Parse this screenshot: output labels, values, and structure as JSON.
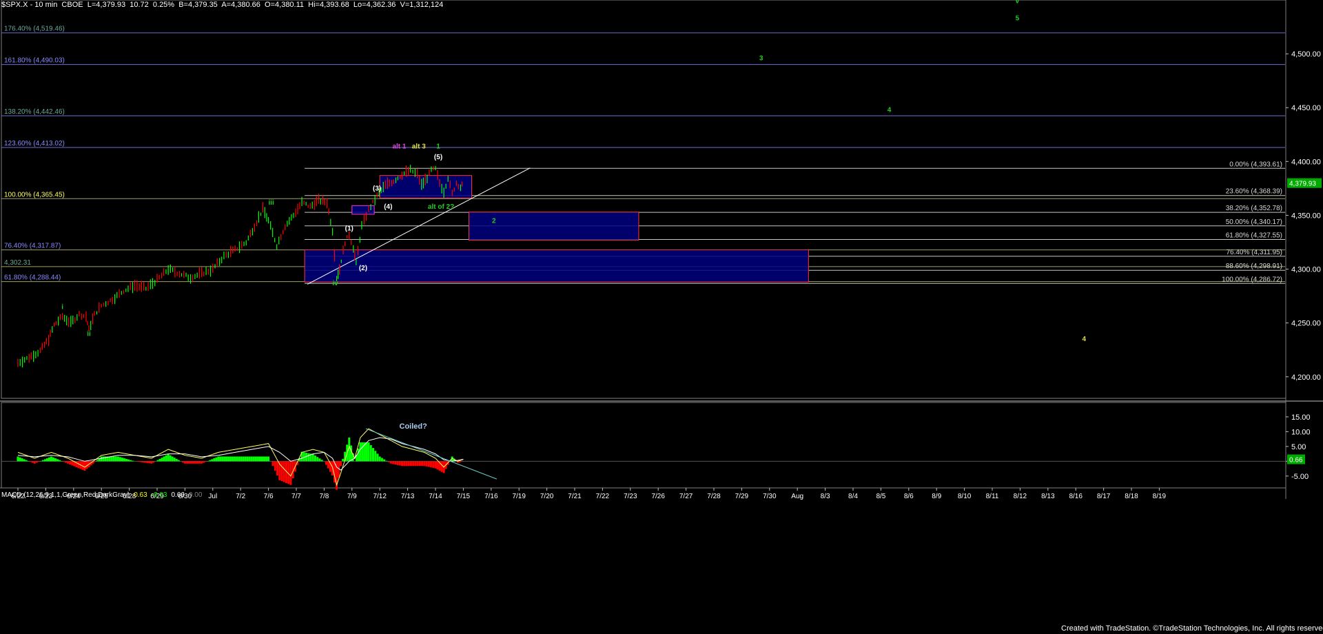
{
  "header": {
    "symbol": "$SPX.X - 10 min  CBOE",
    "last": "L=4,379.93",
    "change": "10.72",
    "change_pct": "0.25%",
    "bid": "B=4,379.35",
    "ask": "A=4,380.66",
    "open": "O=4,380.11",
    "high": "Hi=4,393.68",
    "low": "Lo=4,362.36",
    "volume": "V=1,312,124"
  },
  "macd_header": {
    "label": "MACD (12,26,9,1,1,Green,Red,DarkGray)",
    "v1": "0.63",
    "v2": "-0.03",
    "v3": "0.66",
    "v4": "0.00"
  },
  "footer": "Created with TradeStation. ©TradeStation Technologies, Inc. All rights reserved.",
  "colors": {
    "background": "#000000",
    "up_candle": "#00ff00",
    "down_candle": "#ff0000",
    "box_fill": "#00007f",
    "box_border": "#ff3333",
    "fib_left": "#8080ff",
    "fib_right": "#ffffff",
    "wave_green": "#00cc00",
    "wave_yellow": "#cccc33",
    "wave_magenta": "#cc33cc"
  },
  "chart_data": [
    {
      "type": "candlestick",
      "title": "$SPX.X - 10 min",
      "ylim": [
        4180,
        4550
      ],
      "y_ticks": [
        "4,200.00",
        "4,250.00",
        "4,300.00",
        "4,350.00",
        "4,400.00",
        "4,450.00",
        "4,500.00"
      ],
      "y_tick_values": [
        4200,
        4250,
        4300,
        4350,
        4400,
        4450,
        4500
      ],
      "last_price_label": "4,379.93",
      "last_price": 4379.93,
      "x_ticks": [
        "6/22",
        "6/23",
        "6/24",
        "6/25",
        "6/28",
        "6/29",
        "6/30",
        "Jul",
        "7/2",
        "7/6",
        "7/7",
        "7/8",
        "7/9",
        "7/12",
        "7/13",
        "7/14",
        "7/15",
        "7/16",
        "7/19",
        "7/20",
        "7/21",
        "7/22",
        "7/23",
        "7/26",
        "7/27",
        "7/28",
        "7/29",
        "7/30",
        "Aug",
        "8/3",
        "8/4",
        "8/5",
        "8/6",
        "8/9",
        "8/10",
        "8/11",
        "8/12",
        "8/13",
        "8/16",
        "8/17",
        "8/18",
        "8/19"
      ],
      "price_path": [
        [
          0,
          4213
        ],
        [
          0.4,
          4218
        ],
        [
          0.8,
          4224
        ],
        [
          1.1,
          4235
        ],
        [
          1.3,
          4248
        ],
        [
          1.6,
          4256
        ],
        [
          1.9,
          4250
        ],
        [
          2.2,
          4258
        ],
        [
          2.45,
          4256
        ],
        [
          2.55,
          4244
        ],
        [
          2.75,
          4258
        ],
        [
          3.0,
          4266
        ],
        [
          3.4,
          4272
        ],
        [
          3.8,
          4280
        ],
        [
          4.2,
          4285
        ],
        [
          4.6,
          4282
        ],
        [
          5.0,
          4290
        ],
        [
          5.4,
          4300
        ],
        [
          5.8,
          4296
        ],
        [
          6.2,
          4292
        ],
        [
          6.6,
          4296
        ],
        [
          7.0,
          4300
        ],
        [
          7.4,
          4312
        ],
        [
          7.8,
          4318
        ],
        [
          8.2,
          4325
        ],
        [
          8.5,
          4340
        ],
        [
          8.8,
          4356
        ],
        [
          9.0,
          4345
        ],
        [
          9.3,
          4322
        ],
        [
          9.6,
          4340
        ],
        [
          9.9,
          4350
        ],
        [
          10.2,
          4362
        ],
        [
          10.5,
          4358
        ],
        [
          10.8,
          4364
        ],
        [
          11.1,
          4362
        ],
        [
          11.3,
          4336
        ],
        [
          11.45,
          4292
        ],
        [
          11.55,
          4300
        ],
        [
          11.75,
          4325
        ],
        [
          11.9,
          4332
        ],
        [
          12.05,
          4320
        ],
        [
          12.15,
          4305
        ],
        [
          12.35,
          4340
        ],
        [
          12.6,
          4355
        ],
        [
          12.9,
          4368
        ],
        [
          13.2,
          4378
        ],
        [
          13.5,
          4382
        ],
        [
          13.8,
          4388
        ],
        [
          14.1,
          4392
        ],
        [
          14.35,
          4388
        ],
        [
          14.5,
          4378
        ],
        [
          14.7,
          4385
        ],
        [
          14.85,
          4392
        ],
        [
          15.0,
          4393
        ],
        [
          15.15,
          4380
        ],
        [
          15.3,
          4372
        ],
        [
          15.45,
          4385
        ],
        [
          15.6,
          4370
        ],
        [
          15.75,
          4380
        ],
        [
          15.9,
          4376
        ],
        [
          16.0,
          4379.93
        ]
      ],
      "fib_levels_left": [
        {
          "label": "176.40% (4,519.46)",
          "price": 4519.46
        },
        {
          "label": "161.80% (4,490.03)",
          "price": 4490.03
        },
        {
          "label": "138.20% (4,442.46)",
          "price": 4442.46
        },
        {
          "label": "123.60% (4,413.02)",
          "price": 4413.02
        },
        {
          "label": "100.00% (4,365.45)",
          "price": 4365.45
        },
        {
          "label": "76.40% (4,317.87)",
          "price": 4317.87
        },
        {
          "label": "4,302.31",
          "price": 4302.31
        },
        {
          "label": "61.80% (4,288.44)",
          "price": 4288.44
        }
      ],
      "fib_levels_right": [
        {
          "label": "0.00% (4,393.61)",
          "price": 4393.61
        },
        {
          "label": "23.60% (4,368.39)",
          "price": 4368.39
        },
        {
          "label": "38.20% (4,352.78)",
          "price": 4352.78
        },
        {
          "label": "50.00% (4,340.17)",
          "price": 4340.17
        },
        {
          "label": "61.80% (4,327.55)",
          "price": 4327.55
        },
        {
          "label": "76.40% (4,311.95)",
          "price": 4311.95
        },
        {
          "label": "88.60% (4,298.91)",
          "price": 4298.91
        },
        {
          "label": "100.00% (4,286.72)",
          "price": 4286.72
        }
      ],
      "target_boxes": [
        {
          "x0": 13.0,
          "x1": 16.3,
          "top": 4387,
          "bottom": 4366
        },
        {
          "x0": 12.0,
          "x1": 12.8,
          "top": 4359,
          "bottom": 4351
        },
        {
          "x0": 16.2,
          "x1": 22.3,
          "top": 4353,
          "bottom": 4327
        },
        {
          "x0": 10.3,
          "x1": 28.4,
          "top": 4318,
          "bottom": 4288
        }
      ],
      "trendline": [
        [
          10.4,
          4286
        ],
        [
          18.4,
          4394
        ]
      ],
      "wave_labels": [
        {
          "text": "i",
          "x": 1.6,
          "price": 4263,
          "color": "green"
        },
        {
          "text": "ii",
          "x": 2.55,
          "price": 4238,
          "color": "green"
        },
        {
          "text": "iii",
          "x": 9.1,
          "price": 4360,
          "color": "green"
        },
        {
          "text": "iv",
          "x": 11.4,
          "price": 4285,
          "color": "green"
        },
        {
          "text": "v",
          "x": 35.9,
          "price": 4547,
          "color": "green"
        },
        {
          "text": "1",
          "x": 15.1,
          "price": 4412,
          "color": "green"
        },
        {
          "text": "2",
          "x": 17.1,
          "price": 4343,
          "color": "green"
        },
        {
          "text": "3",
          "x": 26.7,
          "price": 4494,
          "color": "green"
        },
        {
          "text": "4",
          "x": 31.3,
          "price": 4446,
          "color": "green"
        },
        {
          "text": "5",
          "x": 35.9,
          "price": 4531,
          "color": "green"
        },
        {
          "text": "4",
          "x": 38.3,
          "price": 4233,
          "color": "yellow"
        },
        {
          "text": "alt 1",
          "x": 13.7,
          "price": 4412,
          "color": "magenta"
        },
        {
          "text": "alt 3",
          "x": 14.4,
          "price": 4412,
          "color": "yellow"
        },
        {
          "text": "(1)",
          "x": 11.9,
          "price": 4336,
          "color": "white"
        },
        {
          "text": "(2)",
          "x": 12.4,
          "price": 4299,
          "color": "white"
        },
        {
          "text": "(3)",
          "x": 12.9,
          "price": 4373,
          "color": "white"
        },
        {
          "text": "(4)",
          "x": 13.3,
          "price": 4356,
          "color": "white"
        },
        {
          "text": "(5)",
          "x": 15.1,
          "price": 4402,
          "color": "white"
        },
        {
          "text": "alt of 2?",
          "x": 15.2,
          "price": 4356,
          "color": "green"
        }
      ]
    },
    {
      "type": "line",
      "title": "MACD (12,26,9,1,1,Green,Red,DarkGray)",
      "ylim": [
        -9,
        18
      ],
      "y_ticks": [
        "15.00",
        "10.00",
        "5.00",
        "0.00",
        "-5.00"
      ],
      "y_tick_values": [
        15,
        10,
        5,
        0,
        -5
      ],
      "current_value_label": "0.66",
      "annotation": "Coiled?",
      "series": [
        {
          "name": "MACD",
          "values": [
            [
              0,
              3
            ],
            [
              0.6,
              1
            ],
            [
              1.2,
              3
            ],
            [
              1.8,
              1
            ],
            [
              2.4,
              -2
            ],
            [
              3.0,
              2
            ],
            [
              3.6,
              3
            ],
            [
              4.2,
              2
            ],
            [
              4.8,
              1
            ],
            [
              5.4,
              4
            ],
            [
              6.0,
              2
            ],
            [
              6.6,
              1
            ],
            [
              7.2,
              3
            ],
            [
              7.8,
              4
            ],
            [
              8.4,
              5
            ],
            [
              9.0,
              6
            ],
            [
              9.4,
              -1
            ],
            [
              9.8,
              -5
            ],
            [
              10.2,
              3
            ],
            [
              10.6,
              4
            ],
            [
              11.0,
              3
            ],
            [
              11.3,
              -2
            ],
            [
              11.45,
              -8
            ],
            [
              11.6,
              -4
            ],
            [
              11.9,
              5
            ],
            [
              12.1,
              1
            ],
            [
              12.3,
              8
            ],
            [
              12.6,
              11
            ],
            [
              13.0,
              9
            ],
            [
              13.4,
              7
            ],
            [
              13.8,
              5
            ],
            [
              14.2,
              4
            ],
            [
              14.6,
              3
            ],
            [
              15.0,
              1
            ],
            [
              15.3,
              -2
            ],
            [
              15.6,
              1
            ],
            [
              15.8,
              0
            ],
            [
              16.0,
              0.63
            ]
          ]
        },
        {
          "name": "Signal",
          "values": [
            [
              0,
              2
            ],
            [
              0.6,
              1.5
            ],
            [
              1.2,
              2
            ],
            [
              1.8,
              1.5
            ],
            [
              2.4,
              0
            ],
            [
              3.0,
              1
            ],
            [
              3.6,
              2
            ],
            [
              4.2,
              2
            ],
            [
              4.8,
              1.5
            ],
            [
              5.4,
              2.5
            ],
            [
              6.0,
              2.5
            ],
            [
              6.6,
              1.5
            ],
            [
              7.2,
              2
            ],
            [
              7.8,
              3
            ],
            [
              8.4,
              4
            ],
            [
              9.0,
              5
            ],
            [
              9.4,
              3
            ],
            [
              9.8,
              0
            ],
            [
              10.2,
              1
            ],
            [
              10.6,
              2.5
            ],
            [
              11.0,
              3
            ],
            [
              11.3,
              1
            ],
            [
              11.45,
              -2
            ],
            [
              11.6,
              -3
            ],
            [
              11.9,
              0
            ],
            [
              12.1,
              1
            ],
            [
              12.3,
              4
            ],
            [
              12.6,
              7
            ],
            [
              13.0,
              8
            ],
            [
              13.4,
              7.5
            ],
            [
              13.8,
              6
            ],
            [
              14.2,
              5
            ],
            [
              14.6,
              4
            ],
            [
              15.0,
              2.5
            ],
            [
              15.3,
              0.5
            ],
            [
              15.6,
              0
            ],
            [
              15.8,
              0.3
            ],
            [
              16.0,
              0.66
            ]
          ]
        }
      ],
      "trendline": [
        [
          12.5,
          11
        ],
        [
          17.2,
          -6
        ]
      ]
    }
  ]
}
